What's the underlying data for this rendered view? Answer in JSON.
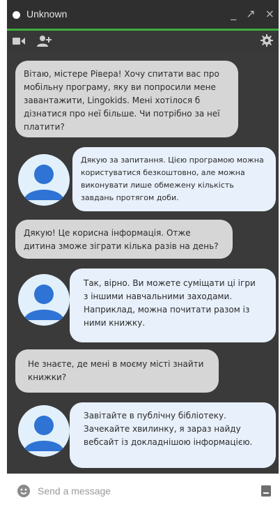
{
  "window": {
    "title": "Unknown",
    "controls": [
      "_",
      "↗",
      "×"
    ],
    "accent_color": "#3fae3f"
  },
  "toolbar": {
    "icons": [
      "video-icon",
      "add-person-icon",
      "settings-icon"
    ]
  },
  "messages": [
    {
      "direction": "incoming",
      "text": "Вітаю, містере Рівера! Хочу спитати вас про мобільну програму, яку ви попросили мене завантажити, Lingokids. Мені хотілося б дізнатися про неї більше. Чи потрібно за неї платити?"
    },
    {
      "direction": "outgoing",
      "avatar": true,
      "text": "Дякую за запитання. Цією програмою можна користуватися безкоштовно, але можна виконувати лише обмежену кількість завдань протягом доби."
    },
    {
      "direction": "incoming",
      "text": "Дякую! Це корисна інформація. Отже дитина зможе зіграти кілька разів на день?"
    },
    {
      "direction": "outgoing",
      "avatar": true,
      "text": "Так, вірно. Ви можете суміщати ці ігри з іншими навчальними заходами. Наприклад, можна почитати разом із ними книжку."
    },
    {
      "direction": "incoming",
      "text": "Не знаєте, де мені в моєму місті знайти книжки?"
    },
    {
      "direction": "outgoing",
      "avatar": true,
      "text": "Завітайте в публічну бібліотеку. Зачекайте хвилинку, я зараз найду вебсайт із докладнішою інформацією."
    }
  ],
  "composer": {
    "placeholder": "Send a message",
    "icons": [
      "emoji-icon",
      "attach-icon"
    ]
  }
}
